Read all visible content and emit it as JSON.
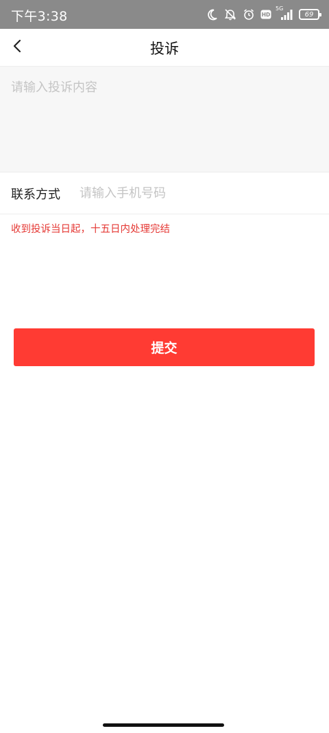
{
  "status_bar": {
    "time": "下午3:38",
    "network": "5G",
    "battery_level": "69",
    "icons": [
      "moon-icon",
      "mute-icon",
      "alarm-icon",
      "hd-icon",
      "signal-icon",
      "battery-icon"
    ]
  },
  "header": {
    "title": "投诉",
    "back_icon": "chevron-left-icon"
  },
  "form": {
    "complaint_placeholder": "请输入投诉内容",
    "contact_label": "联系方式",
    "contact_placeholder": "请输入手机号码",
    "notice": "收到投诉当日起，十五日内处理完结",
    "submit_label": "提交"
  },
  "colors": {
    "accent": "#ff3b33",
    "notice_text": "#e53935",
    "status_bar_bg": "#8a8a8a"
  }
}
